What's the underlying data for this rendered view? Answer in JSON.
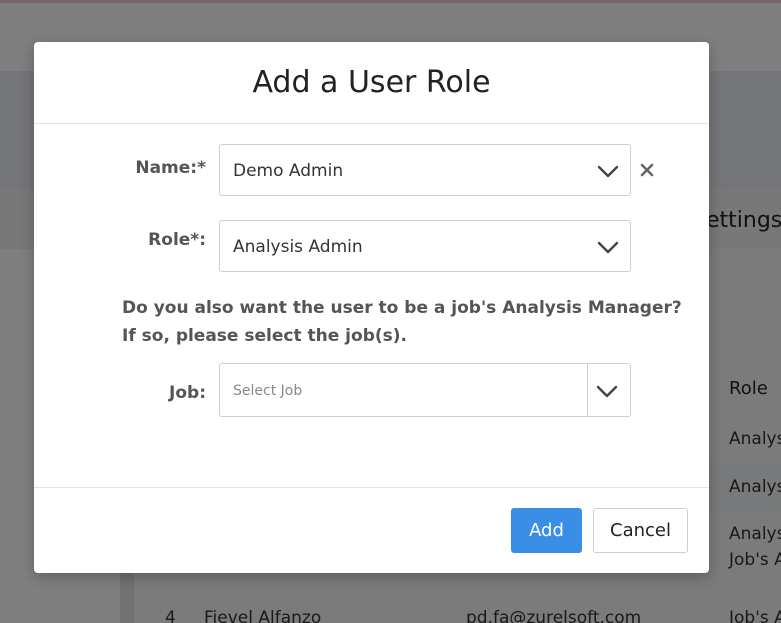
{
  "background": {
    "section_title_partial": "ettings",
    "table_header_role": "Role",
    "rows": [
      {
        "role": "Analys"
      },
      {
        "role": "Analys"
      },
      {
        "role_line1": "Analys",
        "role_line2": "Job's A"
      }
    ],
    "last_row": {
      "number": "4",
      "name": "Fievel Alfanzo",
      "email": "pd.fa@zurelsoft.com",
      "role": "Job's A"
    }
  },
  "modal": {
    "title": "Add a User Role",
    "name_label": "Name:*",
    "name_value": "Demo Admin",
    "role_label": "Role*:",
    "role_value": "Analysis Admin",
    "question": "Do you also want the user to be a job's Analysis Manager? If so, please select the job(s).",
    "job_label": "Job:",
    "job_placeholder": "Select Job",
    "add_label": "Add",
    "cancel_label": "Cancel"
  },
  "colors": {
    "primary": "#3a8ee6",
    "overlay": "#000000"
  },
  "icons": {
    "chevron": "chevron-down-icon",
    "clear": "close-icon"
  }
}
